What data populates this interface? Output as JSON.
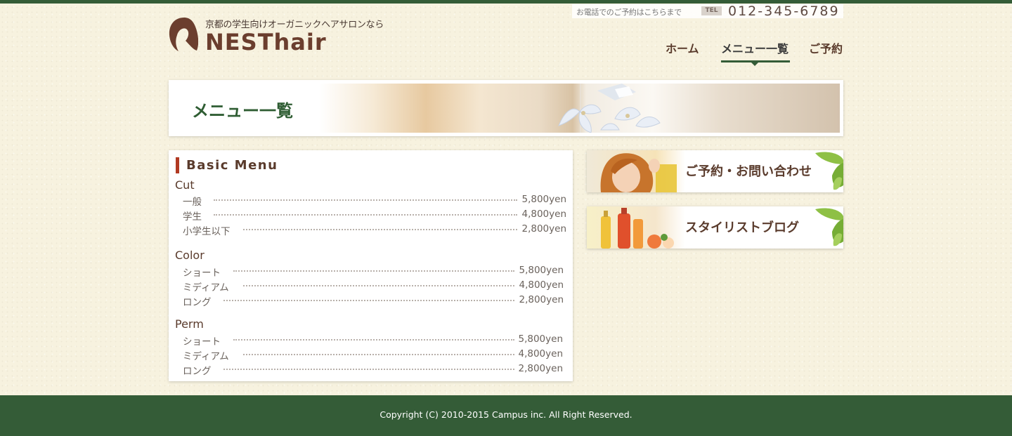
{
  "header": {
    "tagline": "京都の学生向けオーガニックヘアサロンなら",
    "brand": "NESThair",
    "tel_note": "お電話でのご予約はこちらまで",
    "tel_badge": "TEL",
    "tel_number": "012-345-6789"
  },
  "nav": {
    "items": [
      {
        "label": "ホーム"
      },
      {
        "label": "メニュー一覧",
        "active": true
      },
      {
        "label": "ご予約"
      }
    ]
  },
  "banner": {
    "title": "メニュー一覧"
  },
  "menu": {
    "heading": "Basic Menu",
    "categories": [
      {
        "title": "Cut",
        "items": [
          {
            "name": "一般",
            "price": "5,800yen"
          },
          {
            "name": "学生",
            "price": "4,800yen"
          },
          {
            "name": "小学生以下",
            "price": "2,800yen"
          }
        ]
      },
      {
        "title": "Color",
        "items": [
          {
            "name": "ショート",
            "price": "5,800yen"
          },
          {
            "name": "ミディアム",
            "price": "4,800yen"
          },
          {
            "name": "ロング",
            "price": "2,800yen"
          }
        ]
      },
      {
        "title": "Perm",
        "items": [
          {
            "name": "ショート",
            "price": "5,800yen"
          },
          {
            "name": "ミディアム",
            "price": "4,800yen"
          },
          {
            "name": "ロング",
            "price": "2,800yen"
          }
        ]
      }
    ]
  },
  "sidebar": {
    "contact_label": "ご予約・お問い合わせ",
    "blog_label": "スタイリストブログ"
  },
  "footer": {
    "copyright": "Copyright (C) 2010-2015 Campus inc. All Right Reserved."
  },
  "colors": {
    "primary_green": "#345c37",
    "brand_brown": "#6b3e2e",
    "accent_red": "#b13a22",
    "background_cream": "#f7f2df"
  }
}
